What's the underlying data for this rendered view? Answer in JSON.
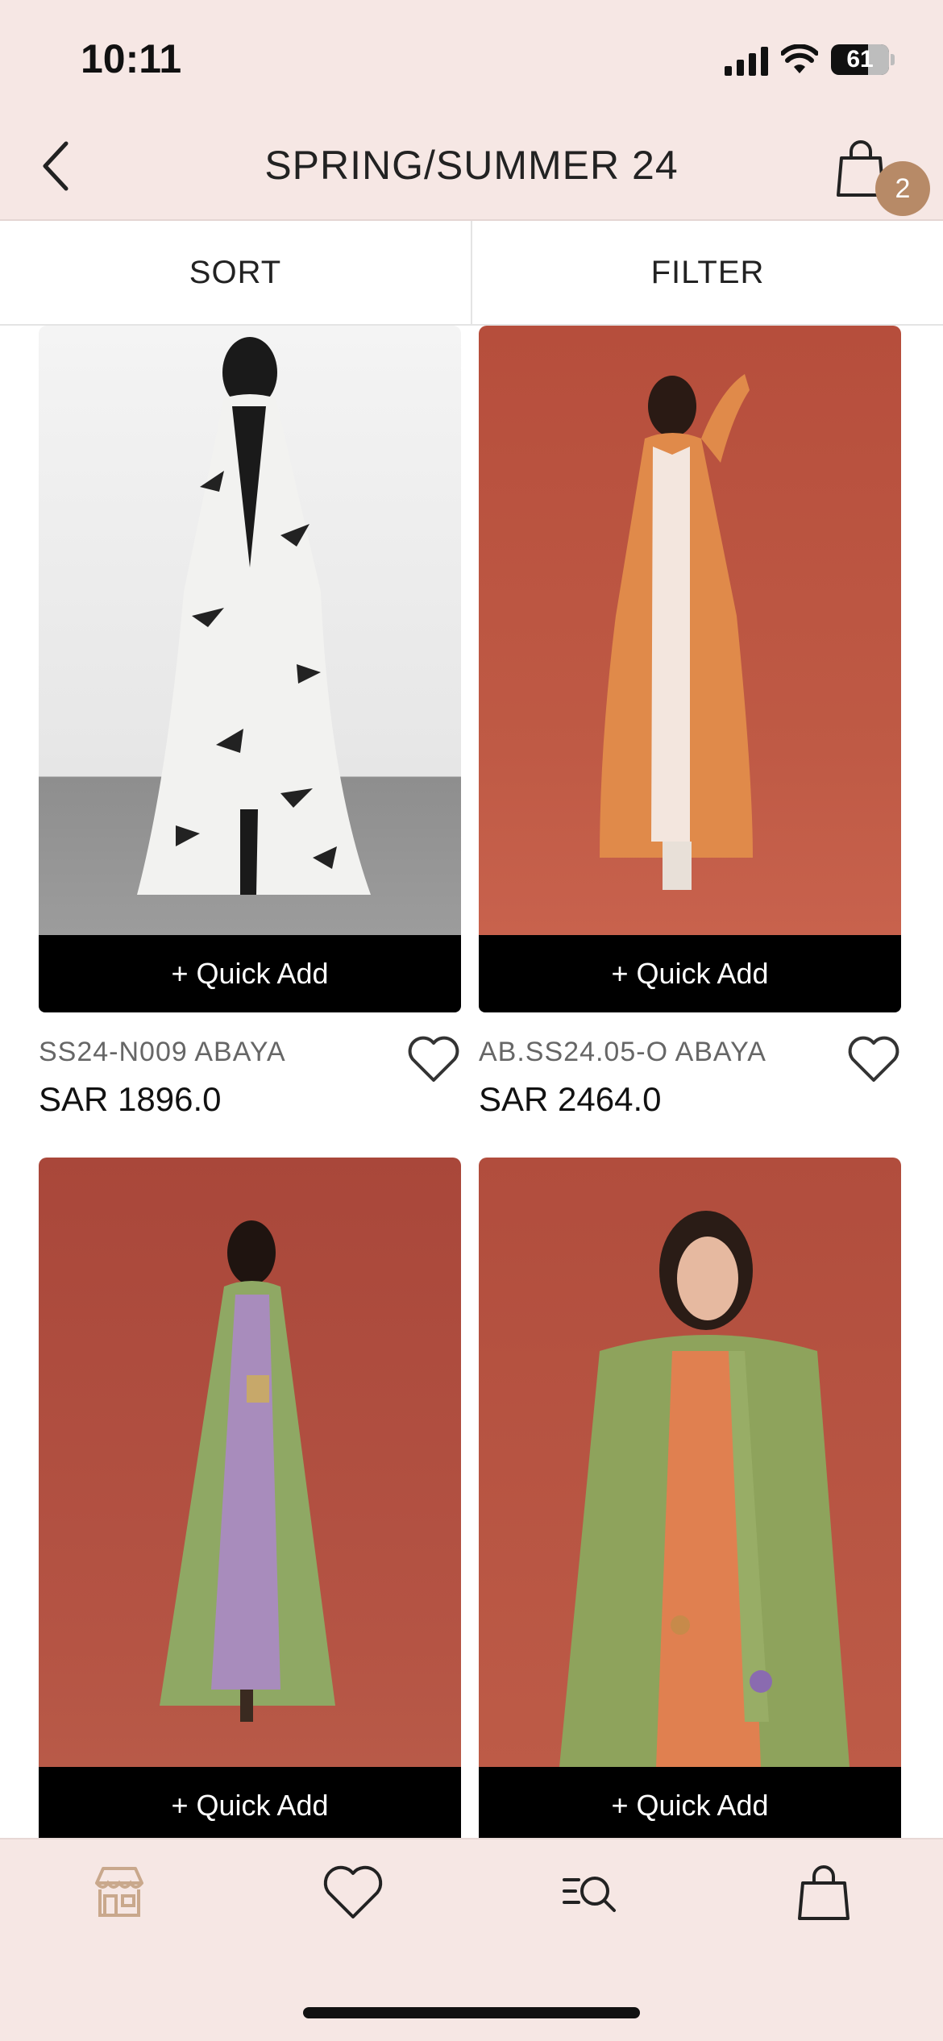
{
  "status_bar": {
    "time": "10:11",
    "battery_level": "61"
  },
  "header": {
    "title": "SPRING/SUMMER 24",
    "cart_count": "2"
  },
  "toolbar": {
    "sort_label": "SORT",
    "filter_label": "FILTER"
  },
  "products": [
    {
      "name": "SS24-N009 ABAYA",
      "price": "SAR 1896.0",
      "quick_add": "+ Quick Add",
      "image": "model-white-black-bird-print-abaya"
    },
    {
      "name": "AB.SS24.05-O ABAYA",
      "price": "SAR 2464.0",
      "quick_add": "+ Quick Add",
      "image": "model-orange-abaya-on-red-background"
    },
    {
      "name": "",
      "price": "",
      "quick_add": "+ Quick Add",
      "image": "model-green-abaya-lilac-dress"
    },
    {
      "name": "",
      "price": "",
      "quick_add": "+ Quick Add",
      "image": "model-green-abaya-orange-dress-closeup"
    }
  ],
  "tab_bar": {
    "items": [
      "store-icon",
      "heart-icon",
      "search-list-icon",
      "bag-icon"
    ],
    "active_color": "#c9a88c",
    "inactive_color": "#222222"
  },
  "colors": {
    "header_bg": "#f6e7e4",
    "badge": "#b78a67",
    "quick_add_bg": "#000000",
    "image_bg_red": "#b5513f"
  }
}
